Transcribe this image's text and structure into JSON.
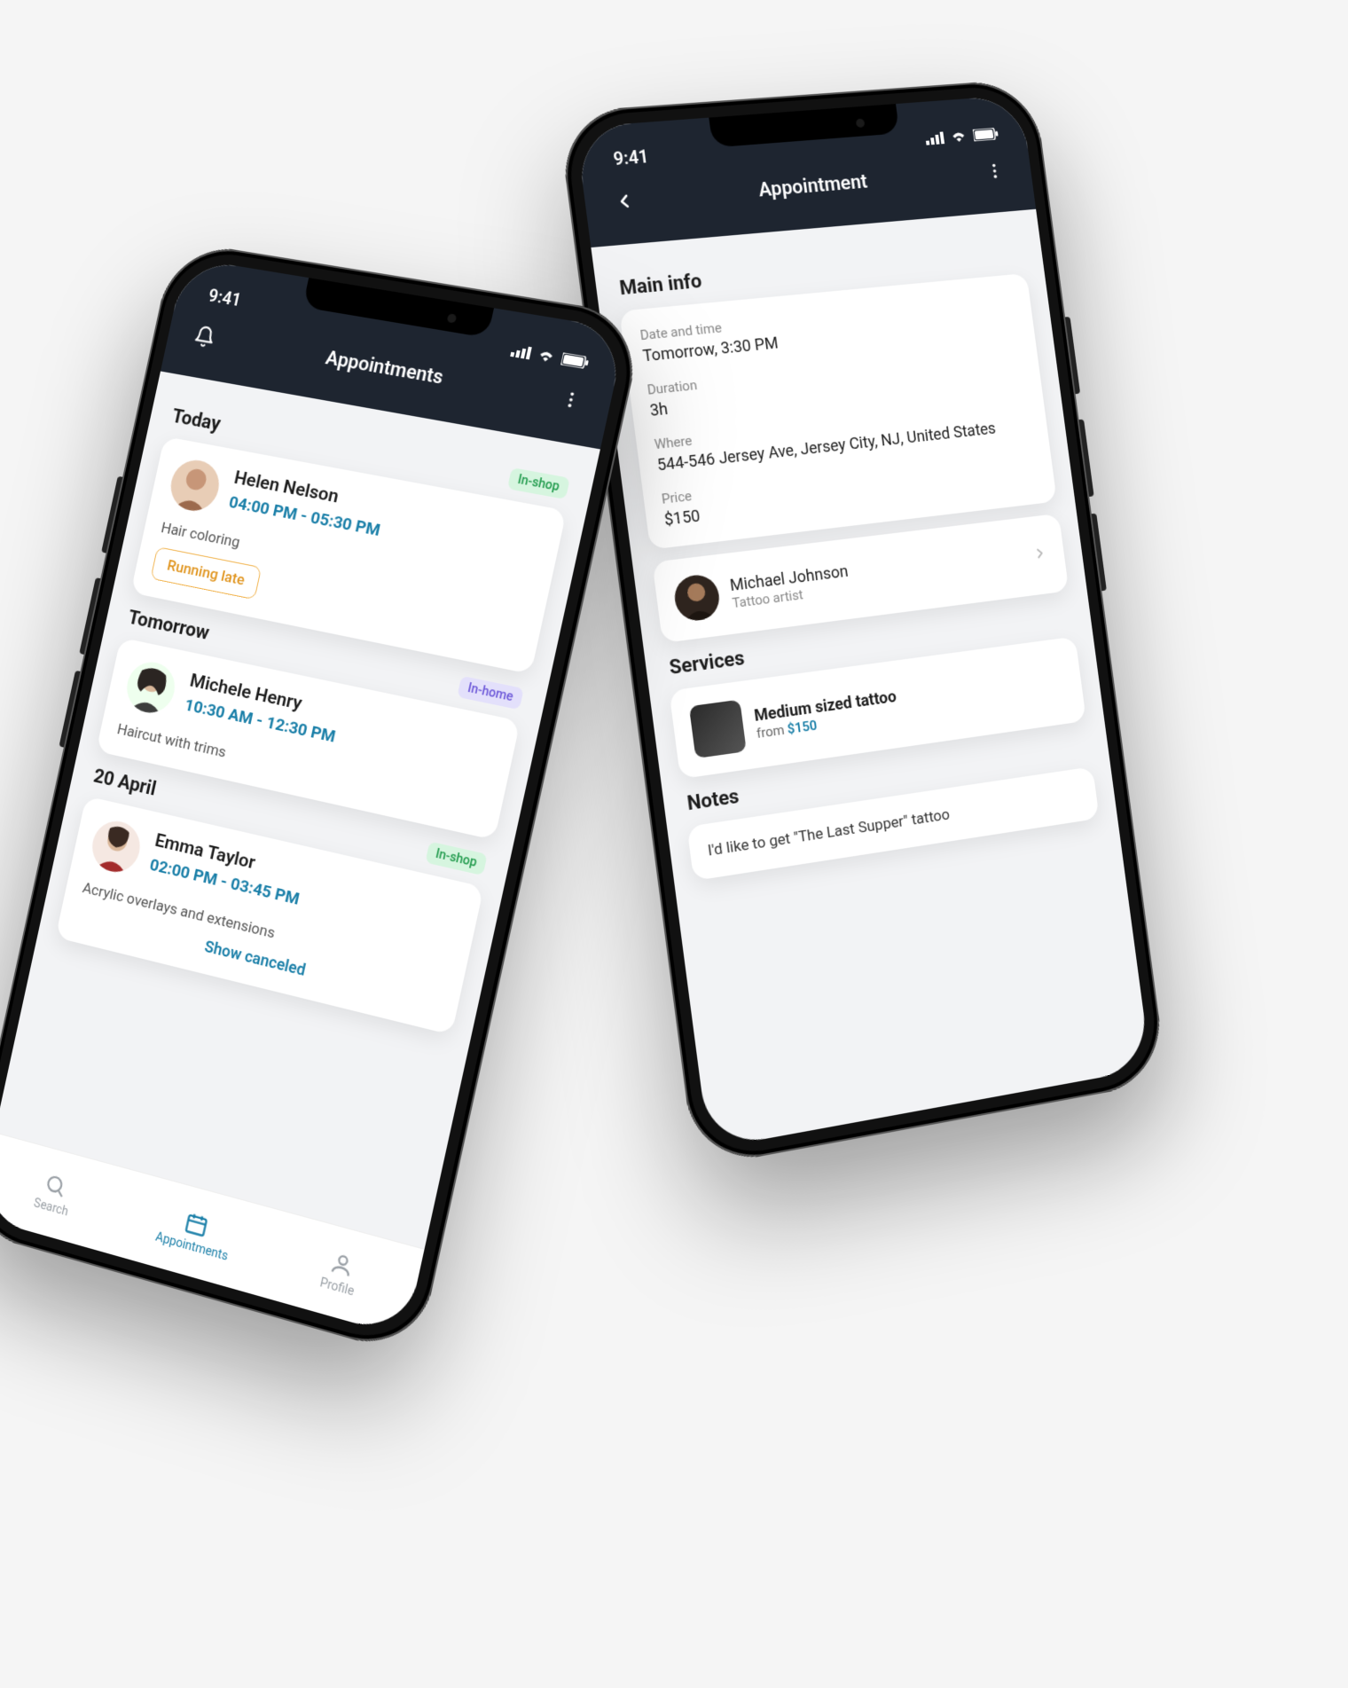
{
  "status": {
    "time": "9:41"
  },
  "left": {
    "title": "Appointments",
    "sections": [
      {
        "header": "Today",
        "badge": "In-shop",
        "badgeKind": "inshop",
        "name": "Helen Nelson",
        "time": "04:00 PM - 05:30 PM",
        "service": "Hair coloring",
        "chip": "Running late"
      },
      {
        "header": "Tomorrow",
        "badge": "In-home",
        "badgeKind": "inhome",
        "name": "Michele Henry",
        "time": "10:30 AM - 12:30 PM",
        "service": "Haircut with trims"
      },
      {
        "header": "20 April",
        "badge": "In-shop",
        "badgeKind": "inshop",
        "name": "Emma Taylor",
        "time": "02:00 PM - 03:45 PM",
        "service": "Acrylic overlays and extensions"
      }
    ],
    "showCanceled": "Show canceled",
    "tabs": {
      "search": "Search",
      "appointments": "Appointments",
      "profile": "Profile"
    }
  },
  "right": {
    "title": "Appointment",
    "mainInfoHeader": "Main info",
    "fields": {
      "datetime_label": "Date and time",
      "datetime_value": "Tomorrow, 3:30 PM",
      "duration_label": "Duration",
      "duration_value": "3h",
      "where_label": "Where",
      "where_value": "544-546 Jersey Ave, Jersey City, NJ, United States",
      "price_label": "Price",
      "price_value": "$150"
    },
    "artist": {
      "name": "Michael Johnson",
      "role": "Tattoo artist"
    },
    "servicesHeader": "Services",
    "service": {
      "title": "Medium sized tattoo",
      "from": "from ",
      "price": "$150"
    },
    "notesHeader": "Notes",
    "notes": "I'd like to get \"The Last Supper\" tattoo"
  }
}
